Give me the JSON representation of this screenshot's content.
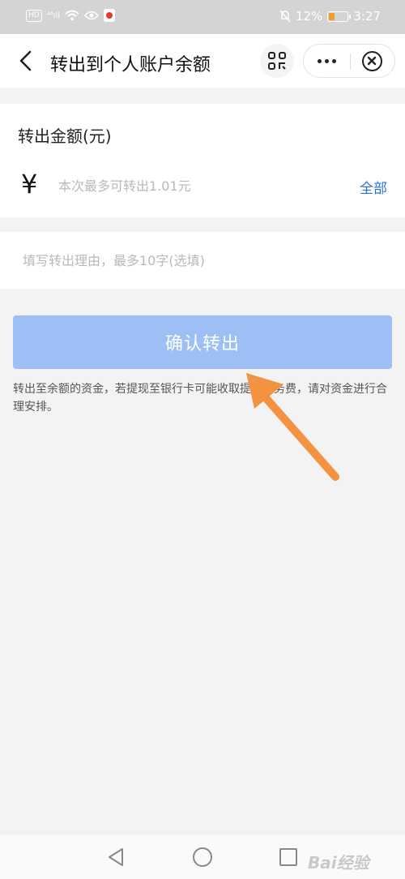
{
  "status_bar": {
    "hd_badge": "HD",
    "signal": "⁴⁶ıll",
    "battery_percent": "12%",
    "battery_level": 0.12,
    "time": "3:27"
  },
  "nav": {
    "title": "转出到个人账户余额"
  },
  "amount_card": {
    "label": "转出金额(元)",
    "currency_symbol": "¥",
    "placeholder": "本次最多可转出1.01元",
    "all_label": "全部"
  },
  "reason_card": {
    "placeholder": "填写转出理由，最多10字(选填)"
  },
  "confirm_button": {
    "label": "确认转出"
  },
  "notice": {
    "text": "转出至余额的资金，若提现至银行卡可能收取提现服务费，请对资金进行合理安排。"
  },
  "watermark": {
    "text": "Bai经验"
  },
  "colors": {
    "confirm_button": "#9dbff5",
    "link": "#2a6fd6",
    "annotation_arrow": "#f39240",
    "background": "#f3f3f3"
  }
}
